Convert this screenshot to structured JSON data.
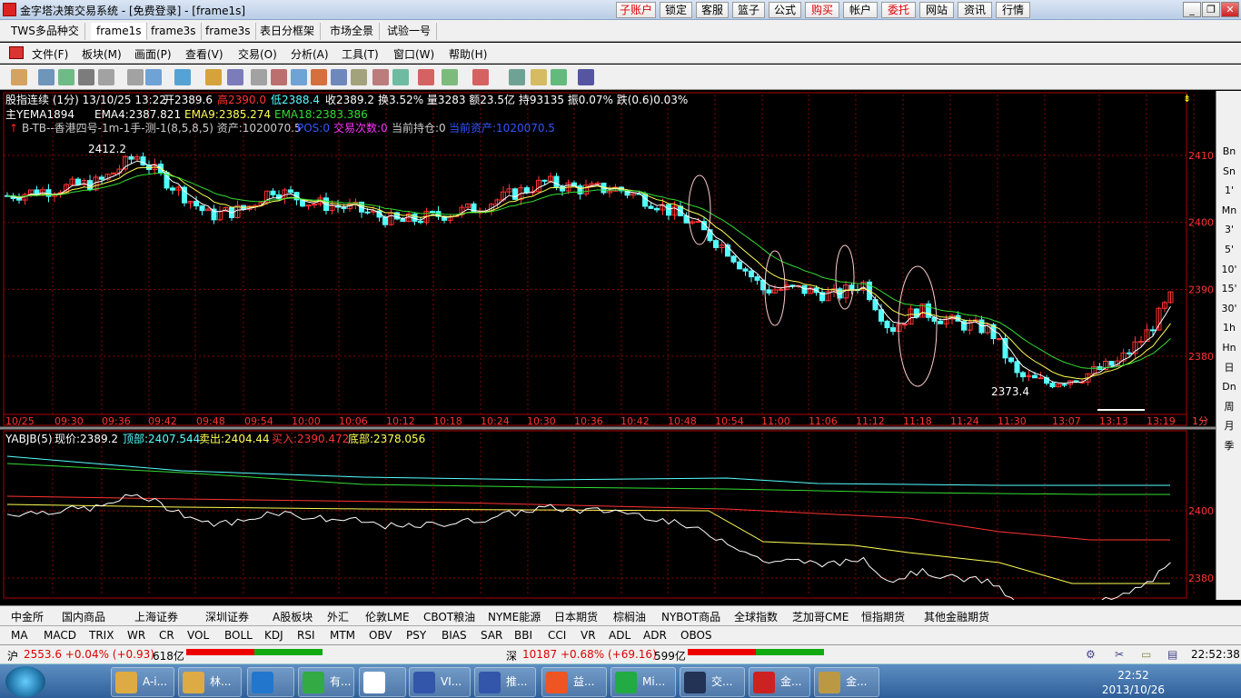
{
  "window": {
    "title": "金字塔决策交易系统 - [免费登录] - [frame1s]",
    "buttons": [
      "子账户",
      "锁定",
      "客服",
      "篮子",
      "公式",
      "购买",
      "帐户",
      "委托",
      "网站",
      "资讯",
      "行情"
    ]
  },
  "tabs": [
    "TWS多品种交",
    "frame1s",
    "frame3s",
    "frame3s",
    "表日分框架",
    "市场全景",
    "试验一号"
  ],
  "menu": [
    "文件(F)",
    "板块(M)",
    "画面(P)",
    "查看(V)",
    "交易(O)",
    "分析(A)",
    "工具(T)",
    "窗口(W)",
    "帮助(H)"
  ],
  "main_chart": {
    "info_line": [
      "股指连续 (1分) 13/10/25 13:22",
      "开2389.6",
      "高2390.0",
      "低2388.4",
      "收2389.2",
      "换3.52% 量3283 额23.5亿 持93135 振0.07% 跌(0.6)0.03%"
    ],
    "ema_line": [
      "主YEMA1894",
      "EMA4:2387.821",
      "EMA9:2385.274",
      "EMA18:2383.386"
    ],
    "strategy_line": [
      "B-TB--香港四号-1m-1手-测-1(8,5,8,5) 资产:1020070.5",
      "POS:0",
      "交易次数:0",
      "当前持仓:0",
      "当前资产:1020070.5"
    ],
    "high_label": "2412.2",
    "low_label": "2373.4",
    "y_ticks": [
      "2410",
      "2400",
      "2390",
      "2380"
    ],
    "x_ticks": [
      "10/25",
      "09:30",
      "09:36",
      "09:42",
      "09:48",
      "09:54",
      "10:00",
      "10:06",
      "10:12",
      "10:18",
      "10:24",
      "10:30",
      "10:36",
      "10:42",
      "10:48",
      "10:54",
      "11:00",
      "11:06",
      "11:12",
      "11:18",
      "11:24",
      "11:30",
      "13:07",
      "13:13",
      "13:19"
    ],
    "period": "1分"
  },
  "sub_chart": {
    "line": [
      "YABJB(5)",
      "现价:2389.2",
      "顶部:2407.544",
      "卖出:2404.44",
      "买入:2390.472",
      "底部:2378.056"
    ],
    "y_ticks": [
      "2400",
      "2380"
    ]
  },
  "right_bar": [
    "Bn",
    "Sn",
    "1'",
    "Mn",
    "3'",
    "5'",
    "10'",
    "15'",
    "30'",
    "1h",
    "Hn",
    "日",
    "Dn",
    "周",
    "月",
    "季"
  ],
  "bottom_tabs": [
    "中金所",
    "国内商品",
    "上海证券",
    "深圳证券",
    "A股板块",
    "外汇",
    "伦敦LME",
    "CBOT粮油",
    "NYME能源",
    "日本期货",
    "棕榈油",
    "NYBOT商品",
    "全球指数",
    "芝加哥CME",
    "恒指期货",
    "其他金融期货"
  ],
  "indicator_tabs": [
    "MA",
    "MACD",
    "TRIX",
    "WR",
    "CR",
    "VOL",
    "BOLL",
    "KDJ",
    "RSI",
    "MTM",
    "OBV",
    "PSY",
    "BIAS",
    "SAR",
    "BBI",
    "CCI",
    "VR",
    "ADL",
    "ADR",
    "OBOS"
  ],
  "status": {
    "sh_label": "沪",
    "sh_value": "2553.6 +0.04% (+0.93)",
    "sh_amount": "618亿",
    "sz_label": "深",
    "sz_value": "10187 +0.68% (+69.16)",
    "sz_amount": "599亿",
    "clock": "22:52:38"
  },
  "taskbar": {
    "items": [
      "A-i...",
      "林...",
      "有...",
      "",
      "VI...",
      "推...",
      "益...",
      "Mi...",
      "交...",
      "金...",
      "金..."
    ],
    "time": "22:52",
    "date": "2013/10/26"
  },
  "colors": {
    "up": "#ff3333",
    "down": "#54ffff",
    "ema4": "#ffffff",
    "ema9": "#ffff55",
    "ema18": "#33dd33",
    "grid": "#8b0000"
  }
}
